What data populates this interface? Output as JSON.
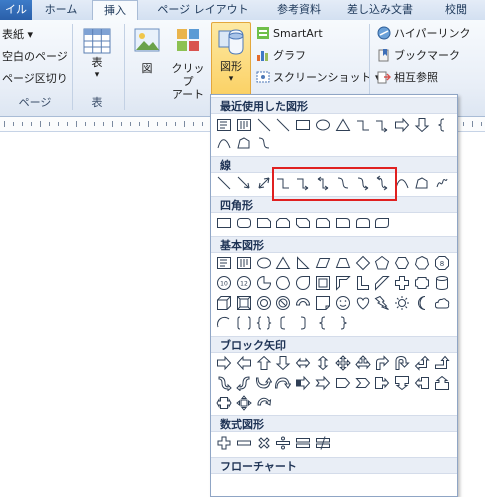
{
  "ribbon_tabs": [
    "イル",
    "ホーム",
    "挿入",
    "ページ レイアウト",
    "参考資料",
    "差し込み文書",
    "校閲"
  ],
  "active_tab": "挿入",
  "page_group": {
    "items": [
      "表紙 ▾",
      "空白のページ",
      "ページ区切り"
    ],
    "label": "ページ"
  },
  "table_group": {
    "button": "表",
    "dropdown": "▾",
    "label": "表"
  },
  "illustrations": {
    "picture": "図",
    "clipart_line1": "クリップ",
    "clipart_line2": "アート",
    "shapes": "図形",
    "shapes_dropdown": "▾",
    "smartart": "SmartArt",
    "chart": "グラフ",
    "screenshot": "スクリーンショット ▾"
  },
  "links": {
    "hyperlink": "ハイパーリンク",
    "bookmark": "ブックマーク",
    "crossref": "相互参照"
  },
  "gallery": {
    "sections": [
      "最近使用した図形",
      "線",
      "四角形",
      "基本図形",
      "ブロック矢印",
      "数式図形",
      "フローチャート"
    ],
    "recent": [
      "text-box",
      "vertical-text-box",
      "line",
      "line",
      "rectangle",
      "oval",
      "triangle",
      "elbow-connector",
      "elbow-arrow",
      "right-arrow",
      "down-arrow",
      "brace",
      "curve",
      "freeform",
      "curved-connector"
    ],
    "lines": [
      "line",
      "arrow",
      "double-arrow",
      "elbow-connector",
      "elbow-arrow-connector",
      "elbow-double-arrow-connector",
      "curved-connector",
      "curved-arrow-connector",
      "curved-double-arrow-connector",
      "curve",
      "freeform",
      "scribble"
    ],
    "rectangles": [
      "rectangle",
      "rounded-rectangle",
      "snip-single-corner",
      "snip-same-side",
      "snip-diagonal",
      "snip-round",
      "round-single-corner",
      "round-same-side",
      "round-diagonal"
    ],
    "basic_row1": [
      "text-box",
      "vertical-text-box",
      "oval",
      "isosceles-triangle",
      "right-triangle",
      "parallelogram",
      "trapezoid",
      "diamond",
      "pentagon",
      "hexagon",
      "heptagon",
      "octagon"
    ],
    "basic_row2": [
      "decagon",
      "dodecagon",
      "pie",
      "chord",
      "teardrop",
      "frame",
      "half-frame",
      "l-shape",
      "diagonal-stripe",
      "cross",
      "plaque",
      "can"
    ],
    "basic_row3": [
      "cube",
      "bevel",
      "donut",
      "no-symbol",
      "block-arc",
      "folded-corner",
      "smiley",
      "heart",
      "lightning",
      "sun",
      "moon",
      "cloud"
    ],
    "basic_row4": [
      "arc",
      "double-bracket",
      "double-brace",
      "left-bracket",
      "right-bracket",
      "left-brace",
      "right-brace"
    ],
    "block_row1": [
      "right-arrow",
      "left-arrow",
      "up-arrow",
      "down-arrow",
      "left-right-arrow",
      "up-down-arrow",
      "quad-arrow",
      "left-right-up-arrow",
      "bent-arrow",
      "u-turn-arrow",
      "left-up-arrow",
      "bent-up-arrow"
    ],
    "block_row2": [
      "curved-right-arrow",
      "curved-left-arrow",
      "curved-up-arrow",
      "curved-down-arrow",
      "striped-right-arrow",
      "notched-right-arrow",
      "pentagon-arrow",
      "chevron",
      "right-arrow-callout",
      "down-arrow-callout",
      "left-arrow-callout",
      "up-arrow-callout"
    ],
    "block_row3": [
      "left-right-arrow-callout",
      "quad-arrow-callout",
      "circular-arrow"
    ],
    "equation": [
      "plus",
      "minus",
      "multiply",
      "division",
      "equal",
      "not-equal"
    ],
    "highlighted_group": "connector-lines"
  }
}
